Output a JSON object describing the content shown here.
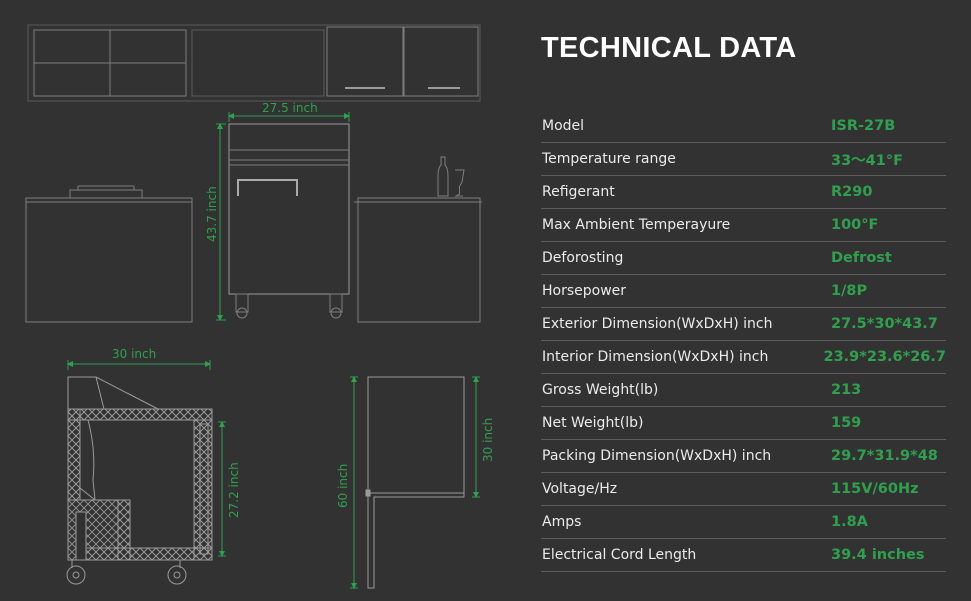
{
  "title": "TECHNICAL DATA",
  "colors": {
    "background": "#323232",
    "accent_green": "#2fa04e",
    "line_art": "#8f8f8f",
    "text": "#ebebeb"
  },
  "dimensions": {
    "front_width": "27.5 inch",
    "front_height": "43.7 inch",
    "side_depth": "30 inch",
    "side_body_height": "27.2 inch",
    "profile_total_height": "60 inch",
    "profile_upper_height": "30 inch"
  },
  "specs": [
    {
      "label": "Model",
      "value": "ISR-27B"
    },
    {
      "label": "Temperature range",
      "value": "33～41°F"
    },
    {
      "label": "Refigerant",
      "value": "R290"
    },
    {
      "label": "Max Ambient Temperayure",
      "value": "100°F"
    },
    {
      "label": "Deforosting",
      "value": "Defrost"
    },
    {
      "label": "Horsepower",
      "value": "1/8P"
    },
    {
      "label": "Exterior Dimension(WxDxH) inch",
      "value": "27.5*30*43.7"
    },
    {
      "label": "Interior Dimension(WxDxH) inch",
      "value": "23.9*23.6*26.7"
    },
    {
      "label": "Gross Weight(lb)",
      "value": "213"
    },
    {
      "label": "Net Weight(lb)",
      "value": "159"
    },
    {
      "label": "Packing Dimension(WxDxH) inch",
      "value": "29.7*31.9*48"
    },
    {
      "label": "Voltage/Hz",
      "value": "115V/60Hz"
    },
    {
      "label": "Amps",
      "value": "1.8A"
    },
    {
      "label": "Electrical Cord Length",
      "value": "39.4 inches"
    }
  ]
}
